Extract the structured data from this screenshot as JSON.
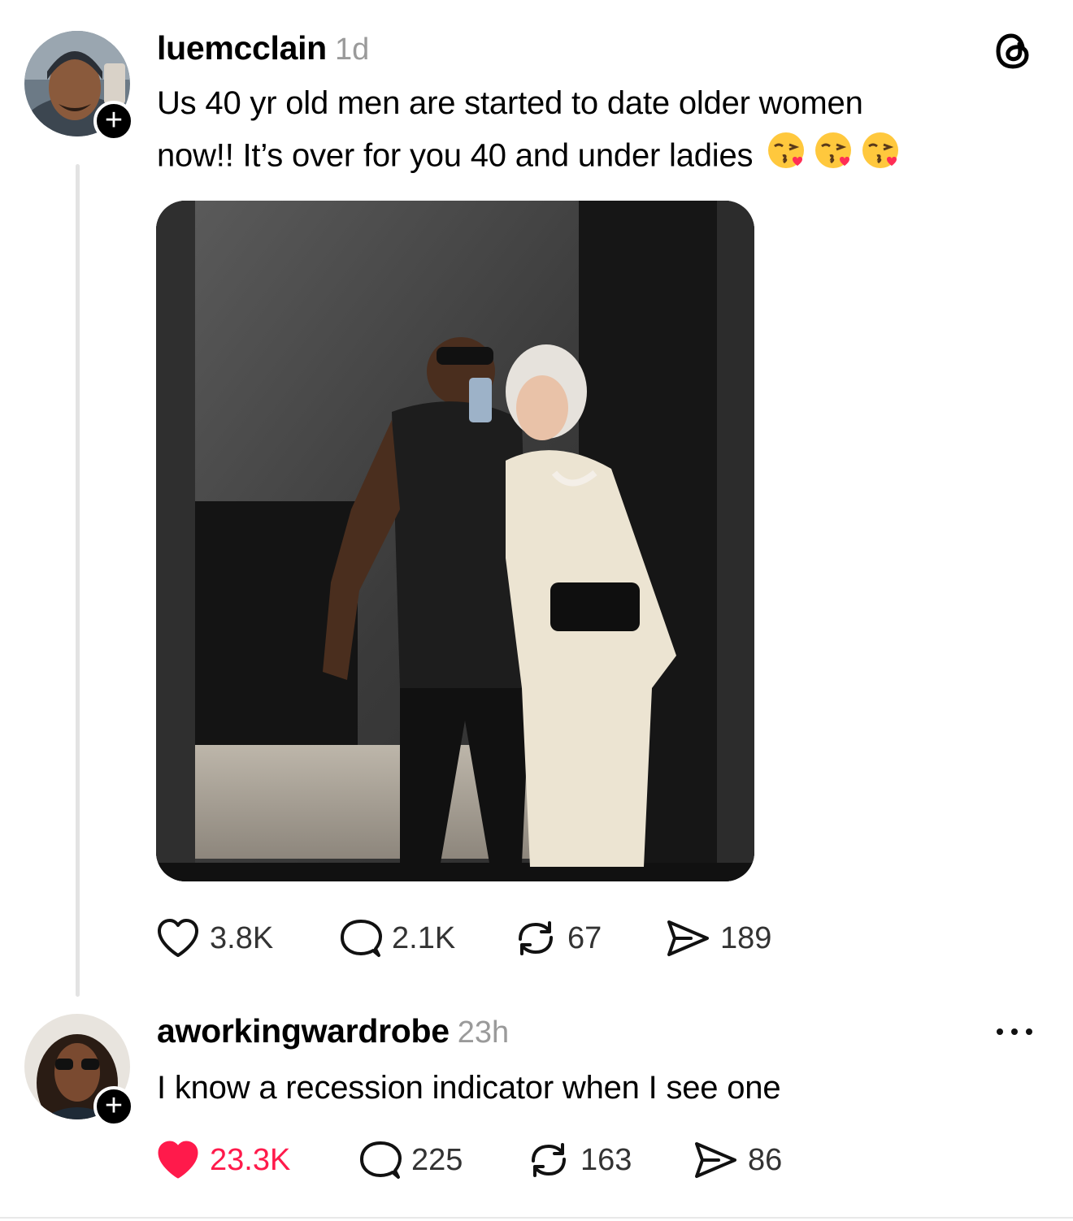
{
  "post": {
    "username": "luemcclain",
    "time": "1d",
    "text_line1": "Us 40 yr old men are started to date older women",
    "text_line2": "now!! It’s over for you 40 and under ladies",
    "emoji_name": "face-blowing-kiss-emoji",
    "stats": {
      "likes": "3.8K",
      "replies": "2.1K",
      "reposts": "67",
      "shares": "189"
    }
  },
  "reply": {
    "username": "aworkingwardrobe",
    "time": "23h",
    "text": "I know a recession indicator when I see one",
    "stats": {
      "likes": "23.3K",
      "replies": "225",
      "reposts": "163",
      "shares": "86"
    }
  },
  "colors": {
    "like_active": "#ff1a4b",
    "muted": "#9a9a9a",
    "line": "#e3e3e3"
  },
  "icons": [
    "threads-logo-icon",
    "heart-icon",
    "reply-bubble-icon",
    "repost-icon",
    "share-send-icon",
    "more-dots-icon",
    "follow-plus-icon"
  ]
}
